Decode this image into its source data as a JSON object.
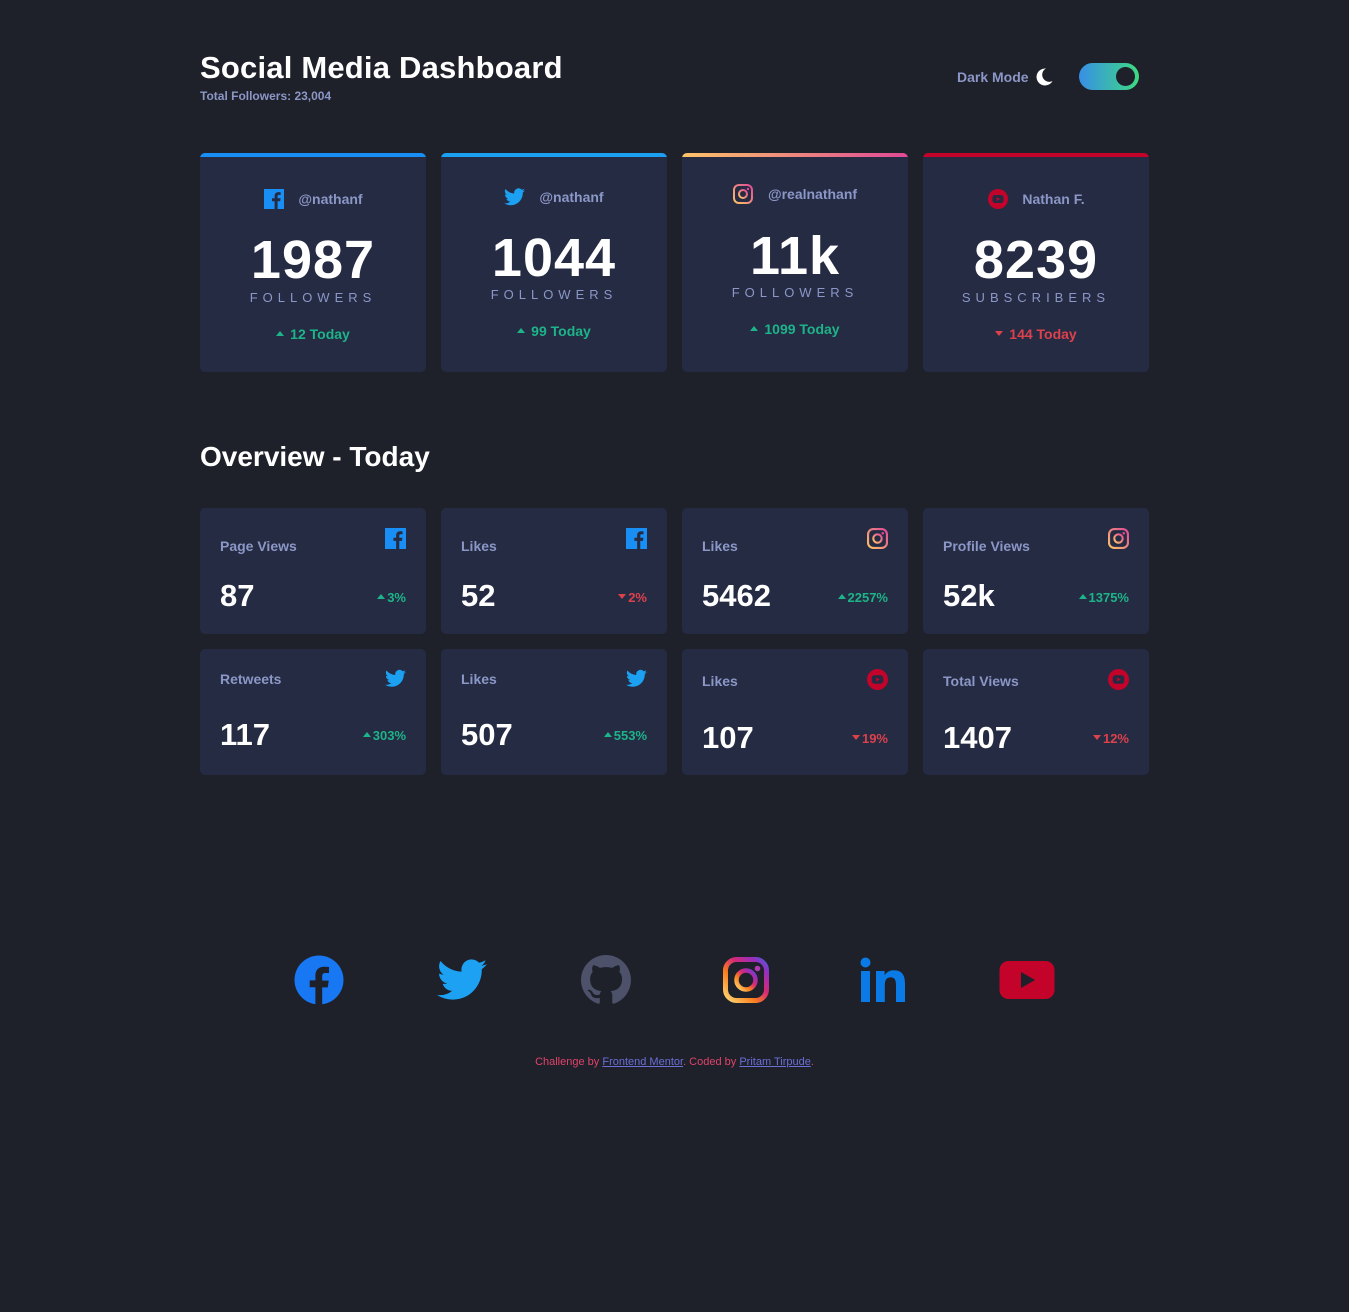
{
  "header": {
    "title": "Social Media Dashboard",
    "total_followers": "Total Followers: 23,004",
    "dark_mode_label": "Dark Mode"
  },
  "colors": {
    "background": "#1e202a",
    "card": "#252b43",
    "text_muted": "#8b97c6",
    "up": "#1db489",
    "down": "#dc414c",
    "facebook": "#198ff5",
    "twitter": "#1ca0f2",
    "youtube": "#c4032a"
  },
  "followers": [
    {
      "platform": "facebook",
      "icon": "facebook-icon",
      "handle": "@nathanf",
      "count": "1987",
      "label": "FOLLOWERS",
      "delta": "12 Today",
      "trend": "up"
    },
    {
      "platform": "twitter",
      "icon": "twitter-icon",
      "handle": "@nathanf",
      "count": "1044",
      "label": "FOLLOWERS",
      "delta": "99 Today",
      "trend": "up"
    },
    {
      "platform": "instagram",
      "icon": "instagram-icon",
      "handle": "@realnathanf",
      "count": "11k",
      "label": "FOLLOWERS",
      "delta": "1099 Today",
      "trend": "up"
    },
    {
      "platform": "youtube",
      "icon": "youtube-icon",
      "handle": "Nathan F.",
      "count": "8239",
      "label": "SUBSCRIBERS",
      "delta": "144 Today",
      "trend": "down"
    }
  ],
  "overview": {
    "title": "Overview - Today",
    "cards": [
      {
        "label": "Page Views",
        "icon": "facebook-icon",
        "value": "87",
        "pct": "3%",
        "trend": "up"
      },
      {
        "label": "Likes",
        "icon": "facebook-icon",
        "value": "52",
        "pct": "2%",
        "trend": "down"
      },
      {
        "label": "Likes",
        "icon": "instagram-icon",
        "value": "5462",
        "pct": "2257%",
        "trend": "up"
      },
      {
        "label": "Profile Views",
        "icon": "instagram-icon",
        "value": "52k",
        "pct": "1375%",
        "trend": "up"
      },
      {
        "label": "Retweets",
        "icon": "twitter-icon",
        "value": "117",
        "pct": "303%",
        "trend": "up"
      },
      {
        "label": "Likes",
        "icon": "twitter-icon",
        "value": "507",
        "pct": "553%",
        "trend": "up"
      },
      {
        "label": "Likes",
        "icon": "youtube-icon",
        "value": "107",
        "pct": "19%",
        "trend": "down"
      },
      {
        "label": "Total Views",
        "icon": "youtube-icon",
        "value": "1407",
        "pct": "12%",
        "trend": "down"
      }
    ]
  },
  "footer": {
    "social_links": [
      "facebook-icon",
      "twitter-icon",
      "github-icon",
      "instagram-icon",
      "linkedin-icon",
      "youtube-icon"
    ],
    "credit_prefix": "Challenge by ",
    "credit_link1": "Frontend Mentor",
    "credit_middle": ". Coded by ",
    "credit_link2": "Pritam Tirpude",
    "credit_suffix": "."
  }
}
